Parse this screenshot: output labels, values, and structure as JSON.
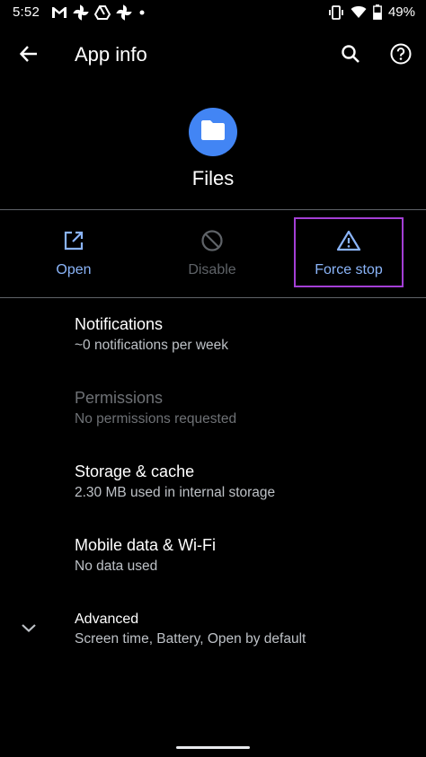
{
  "status_bar": {
    "time": "5:52",
    "battery_percent": "49%",
    "left_icons": [
      "gmail-icon",
      "pinwheel-icon",
      "drive-icon",
      "pinwheel-icon",
      "dot-icon"
    ],
    "right_icons": [
      "vibrate-icon",
      "wifi-icon",
      "battery-icon"
    ]
  },
  "app_bar": {
    "title": "App info",
    "back_icon": "arrow-back-icon",
    "search_icon": "search-icon",
    "help_icon": "help-icon"
  },
  "app": {
    "name": "Files",
    "icon": "folder-icon",
    "icon_color": "#4285f4"
  },
  "actions": [
    {
      "label": "Open",
      "icon": "open-in-new-icon",
      "enabled": true
    },
    {
      "label": "Disable",
      "icon": "disable-icon",
      "enabled": false
    },
    {
      "label": "Force stop",
      "icon": "warning-icon",
      "enabled": true,
      "highlighted": true
    }
  ],
  "settings": [
    {
      "title": "Notifications",
      "summary": "~0 notifications per week",
      "enabled": true
    },
    {
      "title": "Permissions",
      "summary": "No permissions requested",
      "enabled": false
    },
    {
      "title": "Storage & cache",
      "summary": "2.30 MB used in internal storage",
      "enabled": true
    },
    {
      "title": "Mobile data & Wi-Fi",
      "summary": "No data used",
      "enabled": true
    },
    {
      "title": "Advanced",
      "summary": "Screen time, Battery, Open by default",
      "enabled": true,
      "icon": "chevron-down-icon"
    }
  ],
  "colors": {
    "accent": "#8ab4f8",
    "highlight_border": "#a43fd6",
    "background": "#000000",
    "divider": "#5f6368"
  }
}
